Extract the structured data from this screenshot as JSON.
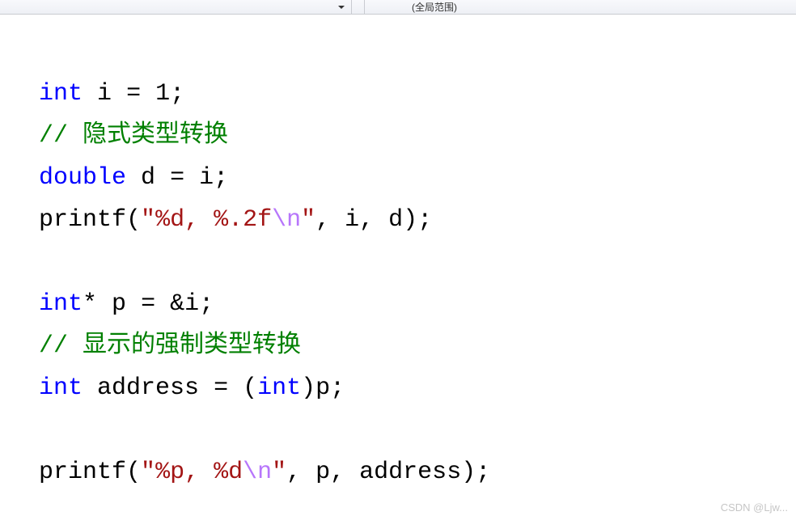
{
  "toolbar": {
    "scope_label": "(全局范围)"
  },
  "code": {
    "line1": {
      "kw": "int",
      "sp1": " ",
      "id": "i",
      "sp2": " ",
      "op": "=",
      "sp3": " ",
      "num": "1",
      "semi": ";"
    },
    "line2": {
      "comment": "// 隐式类型转换"
    },
    "line3": {
      "kw": "double",
      "sp1": " ",
      "id": "d",
      "sp2": " ",
      "op": "=",
      "sp3": " ",
      "id2": "i",
      "semi": ";"
    },
    "line4": {
      "fn": "printf",
      "lp": "(",
      "q1": "\"",
      "s1": "%d, %.2f",
      "esc": "\\n",
      "q2": "\"",
      "c1": ", ",
      "a1": "i",
      "c2": ", ",
      "a2": "d",
      "rp": ")",
      "semi": ";"
    },
    "line6": {
      "kw": "int",
      "star": "*",
      "sp1": " ",
      "id": "p",
      "sp2": " ",
      "op": "=",
      "sp3": " ",
      "amp": "&",
      "id2": "i",
      "semi": ";"
    },
    "line7": {
      "comment": "// 显示的强制类型转换"
    },
    "line8": {
      "kw": "int",
      "sp1": " ",
      "id": "address",
      "sp2": " ",
      "op": "=",
      "sp3": " ",
      "lp": "(",
      "cast": "int",
      "rp": ")",
      "id2": "p",
      "semi": ";"
    },
    "line10": {
      "fn": "printf",
      "lp": "(",
      "q1": "\"",
      "s1": "%p, %d",
      "esc": "\\n",
      "q2": "\"",
      "c1": ", ",
      "a1": "p",
      "c2": ", ",
      "a2": "address",
      "rp": ")",
      "semi": ";"
    }
  },
  "watermark": "CSDN @Ljw..."
}
